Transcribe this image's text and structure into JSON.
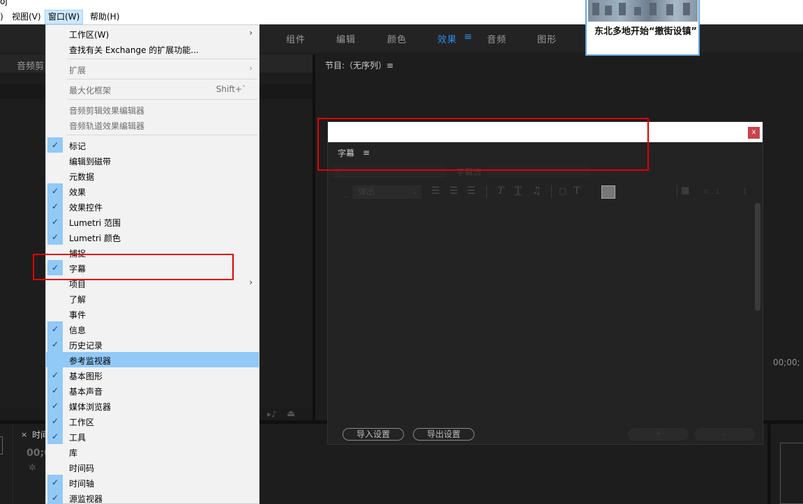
{
  "window_title_fragment": "oj",
  "sys_menu": [
    {
      "label": ")"
    },
    {
      "label": "视图(V)"
    },
    {
      "label": "窗口(W)",
      "active": true
    },
    {
      "label": "帮助(H)"
    }
  ],
  "workspace_tabs": [
    {
      "label": "组件"
    },
    {
      "label": "编辑"
    },
    {
      "label": "颜色"
    },
    {
      "label": "效果",
      "active": true
    },
    {
      "label": "音频"
    },
    {
      "label": "图形"
    }
  ],
  "workspace_menu_icon": "≡",
  "left_panel_title": "音频剪",
  "program_monitor_title": "节目:（无序列）≡",
  "right_timecode": "00;00;",
  "bottom_tab": {
    "close": "×",
    "label": "时间",
    "timecode": "00;0"
  },
  "captions_dialog": {
    "close_label": "x",
    "title": "字幕",
    "title_menu": "≡",
    "stream_label": "字幕流",
    "style_select": "弹出",
    "x_label": "x:",
    "x_value": "1",
    "y_value": "1",
    "import_button": "导入设置",
    "export_button": "导出设置",
    "add_button": "+",
    "remove_button": "-",
    "swatch_color": "#777777"
  },
  "window_menu": {
    "items": [
      {
        "label": "工作区(W)",
        "submenu": true
      },
      {
        "label": "查找有关 Exchange 的扩展功能..."
      },
      {
        "label": "扩展",
        "submenu": true,
        "disabled": true
      },
      {
        "label": "最大化框架",
        "shortcut": "Shift+`",
        "disabled": true
      },
      {
        "label": "音频剪辑效果编辑器",
        "disabled": true
      },
      {
        "label": "音频轨道效果编辑器",
        "disabled": true
      },
      {
        "label": "标记",
        "checked": true
      },
      {
        "label": "编辑到磁带"
      },
      {
        "label": "元数据"
      },
      {
        "label": "效果",
        "checked": true
      },
      {
        "label": "效果控件",
        "checked": true
      },
      {
        "label": "Lumetri 范围",
        "checked": true
      },
      {
        "label": "Lumetri 颜色",
        "checked": true
      },
      {
        "label": "捕捉"
      },
      {
        "label": "字幕",
        "checked": true
      },
      {
        "label": "项目",
        "submenu": true
      },
      {
        "label": "了解"
      },
      {
        "label": "事件"
      },
      {
        "label": "信息",
        "checked": true
      },
      {
        "label": "历史记录",
        "checked": true
      },
      {
        "label": "参考监视器",
        "highlighted": true
      },
      {
        "label": "基本图形",
        "checked": true
      },
      {
        "label": "基本声音",
        "checked": true
      },
      {
        "label": "媒体浏览器",
        "checked": true
      },
      {
        "label": "工作区",
        "checked": true
      },
      {
        "label": "工具",
        "checked": true
      },
      {
        "label": "库"
      },
      {
        "label": "时间码"
      },
      {
        "label": "时间轴",
        "checked": true
      },
      {
        "label": "源监视器",
        "checked": true
      }
    ]
  },
  "news_popup": {
    "headline": "东北多地开始“撤街设镇”"
  },
  "colors": {
    "accent_blue": "#2d8ceb",
    "menu_highlight": "#91c9f7",
    "annotation_red": "#e10000"
  }
}
